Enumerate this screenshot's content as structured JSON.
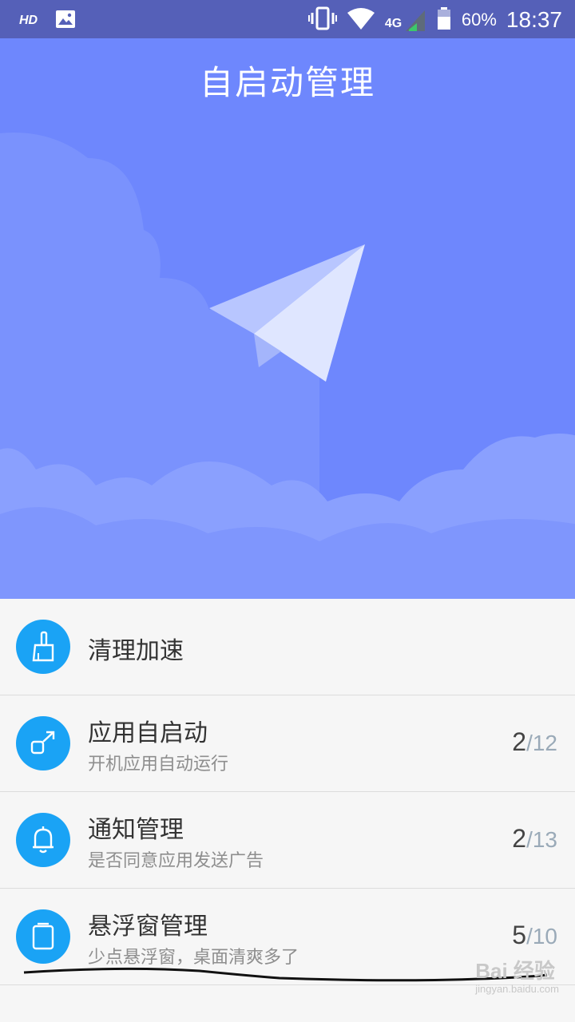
{
  "status_bar": {
    "hd": "HD",
    "network": "4G",
    "battery": "60%",
    "time": "18:37"
  },
  "header": {
    "title": "自启动管理"
  },
  "list": [
    {
      "title": "清理加速",
      "subtitle": "",
      "icon": "broom-icon"
    },
    {
      "title": "应用自启动",
      "subtitle": "开机应用自动运行",
      "current": "2",
      "total": "/12",
      "icon": "launch-arrow-icon"
    },
    {
      "title": "通知管理",
      "subtitle": "是否同意应用发送广告",
      "current": "2",
      "total": "/13",
      "icon": "bell-icon"
    },
    {
      "title": "悬浮窗管理",
      "subtitle": "少点悬浮窗，桌面清爽多了",
      "current": "5",
      "total": "/10",
      "icon": "window-icon"
    }
  ],
  "watermark": {
    "brand": "Bai 经验",
    "url": "jingyan.baidu.com"
  },
  "colors": {
    "hero": "#6e87fd",
    "status_bar": "#5560b8",
    "accent": "#1aa3f5"
  }
}
